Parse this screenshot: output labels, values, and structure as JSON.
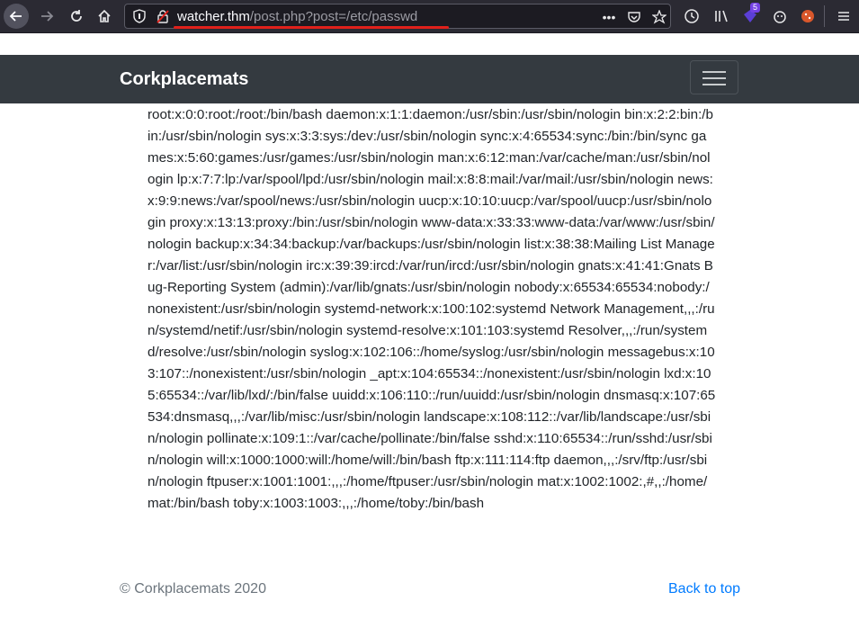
{
  "browser": {
    "url_host": "watcher.thm",
    "url_path": "/post.php?post=/etc/passwd",
    "extension_badge": "5"
  },
  "navbar": {
    "brand": "Corkplacemats"
  },
  "content": {
    "text": "root:x:0:0:root:/root:/bin/bash daemon:x:1:1:daemon:/usr/sbin:/usr/sbin/nologin bin:x:2:2:bin:/bin:/usr/sbin/nologin sys:x:3:3:sys:/dev:/usr/sbin/nologin sync:x:4:65534:sync:/bin:/bin/sync games:x:5:60:games:/usr/games:/usr/sbin/nologin man:x:6:12:man:/var/cache/man:/usr/sbin/nologin lp:x:7:7:lp:/var/spool/lpd:/usr/sbin/nologin mail:x:8:8:mail:/var/mail:/usr/sbin/nologin news:x:9:9:news:/var/spool/news:/usr/sbin/nologin uucp:x:10:10:uucp:/var/spool/uucp:/usr/sbin/nologin proxy:x:13:13:proxy:/bin:/usr/sbin/nologin www-data:x:33:33:www-data:/var/www:/usr/sbin/nologin backup:x:34:34:backup:/var/backups:/usr/sbin/nologin list:x:38:38:Mailing List Manager:/var/list:/usr/sbin/nologin irc:x:39:39:ircd:/var/run/ircd:/usr/sbin/nologin gnats:x:41:41:Gnats Bug-Reporting System (admin):/var/lib/gnats:/usr/sbin/nologin nobody:x:65534:65534:nobody:/nonexistent:/usr/sbin/nologin systemd-network:x:100:102:systemd Network Management,,,:/run/systemd/netif:/usr/sbin/nologin systemd-resolve:x:101:103:systemd Resolver,,,:/run/systemd/resolve:/usr/sbin/nologin syslog:x:102:106::/home/syslog:/usr/sbin/nologin messagebus:x:103:107::/nonexistent:/usr/sbin/nologin _apt:x:104:65534::/nonexistent:/usr/sbin/nologin lxd:x:105:65534::/var/lib/lxd/:/bin/false uuidd:x:106:110::/run/uuidd:/usr/sbin/nologin dnsmasq:x:107:65534:dnsmasq,,,:/var/lib/misc:/usr/sbin/nologin landscape:x:108:112::/var/lib/landscape:/usr/sbin/nologin pollinate:x:109:1::/var/cache/pollinate:/bin/false sshd:x:110:65534::/run/sshd:/usr/sbin/nologin will:x:1000:1000:will:/home/will:/bin/bash ftp:x:111:114:ftp daemon,,,:/srv/ftp:/usr/sbin/nologin ftpuser:x:1001:1001:,,,:/home/ftpuser:/usr/sbin/nologin mat:x:1002:1002:,#,,:/home/mat:/bin/bash toby:x:1003:1003:,,,:/home/toby:/bin/bash"
  },
  "footer": {
    "copyright": "© Corkplacemats 2020",
    "back_to_top": "Back to top"
  },
  "colors": {
    "toolbar_bg": "#2b2a33",
    "navbar_bg": "#343a40",
    "link": "#007bff",
    "url_underline": "#e0201b"
  }
}
